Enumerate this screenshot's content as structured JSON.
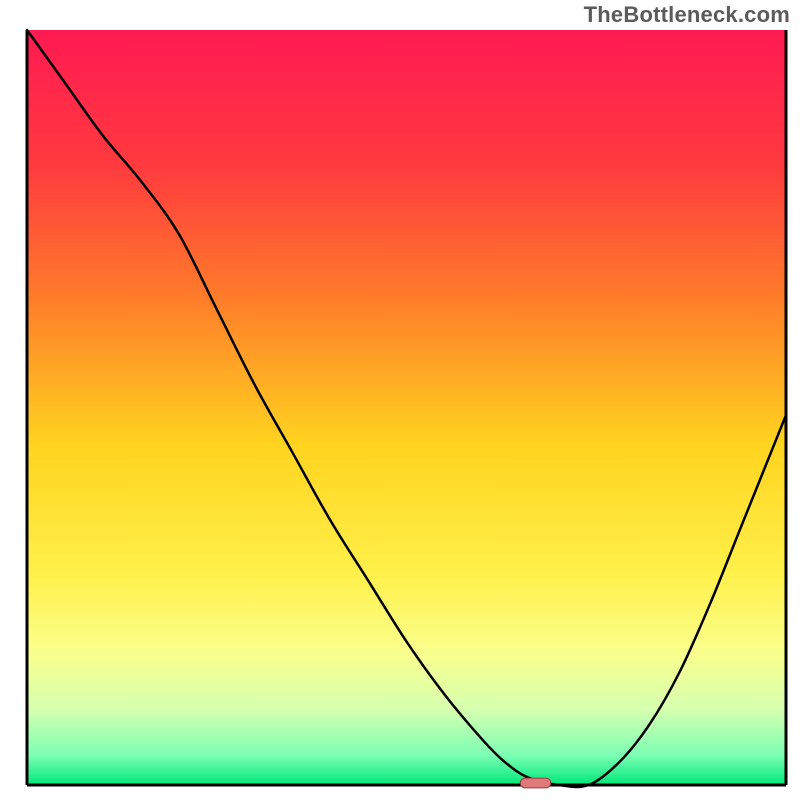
{
  "watermark": "TheBottleneck.com",
  "chart_data": {
    "type": "line",
    "title": "",
    "xlabel": "",
    "ylabel": "",
    "xlim": [
      0,
      100
    ],
    "ylim": [
      0,
      100
    ],
    "axes": {
      "left": true,
      "bottom": true,
      "right": true,
      "top": false,
      "ticks": false,
      "grid": false
    },
    "background_gradient": {
      "orientation": "vertical",
      "stops": [
        {
          "pos": 0.0,
          "color": "#ff1a52"
        },
        {
          "pos": 0.18,
          "color": "#ff3a3f"
        },
        {
          "pos": 0.35,
          "color": "#ff7a2a"
        },
        {
          "pos": 0.55,
          "color": "#ffd41f"
        },
        {
          "pos": 0.72,
          "color": "#fff04a"
        },
        {
          "pos": 0.82,
          "color": "#fbff8a"
        },
        {
          "pos": 0.9,
          "color": "#d6ffb0"
        },
        {
          "pos": 0.96,
          "color": "#7dffb4"
        },
        {
          "pos": 1.0,
          "color": "#00e77a"
        }
      ]
    },
    "series": [
      {
        "name": "curve",
        "color": "#000000",
        "x": [
          0,
          5,
          10,
          15,
          20,
          25,
          30,
          35,
          40,
          45,
          50,
          55,
          60,
          63,
          66,
          70,
          74,
          78,
          82,
          86,
          90,
          94,
          98,
          100
        ],
        "y": [
          100,
          93,
          86,
          80,
          73,
          63,
          53,
          44,
          35,
          27,
          19,
          12,
          6,
          3,
          1,
          0,
          0,
          3,
          8,
          15,
          24,
          34,
          44,
          49
        ]
      }
    ],
    "marker": {
      "name": "optimal-point",
      "shape": "rounded-rect",
      "center_x": 67,
      "center_y": 0,
      "width_x": 4,
      "height_y": 1.3,
      "fill": "#e07a7a",
      "stroke": "#9a3d3d"
    }
  }
}
